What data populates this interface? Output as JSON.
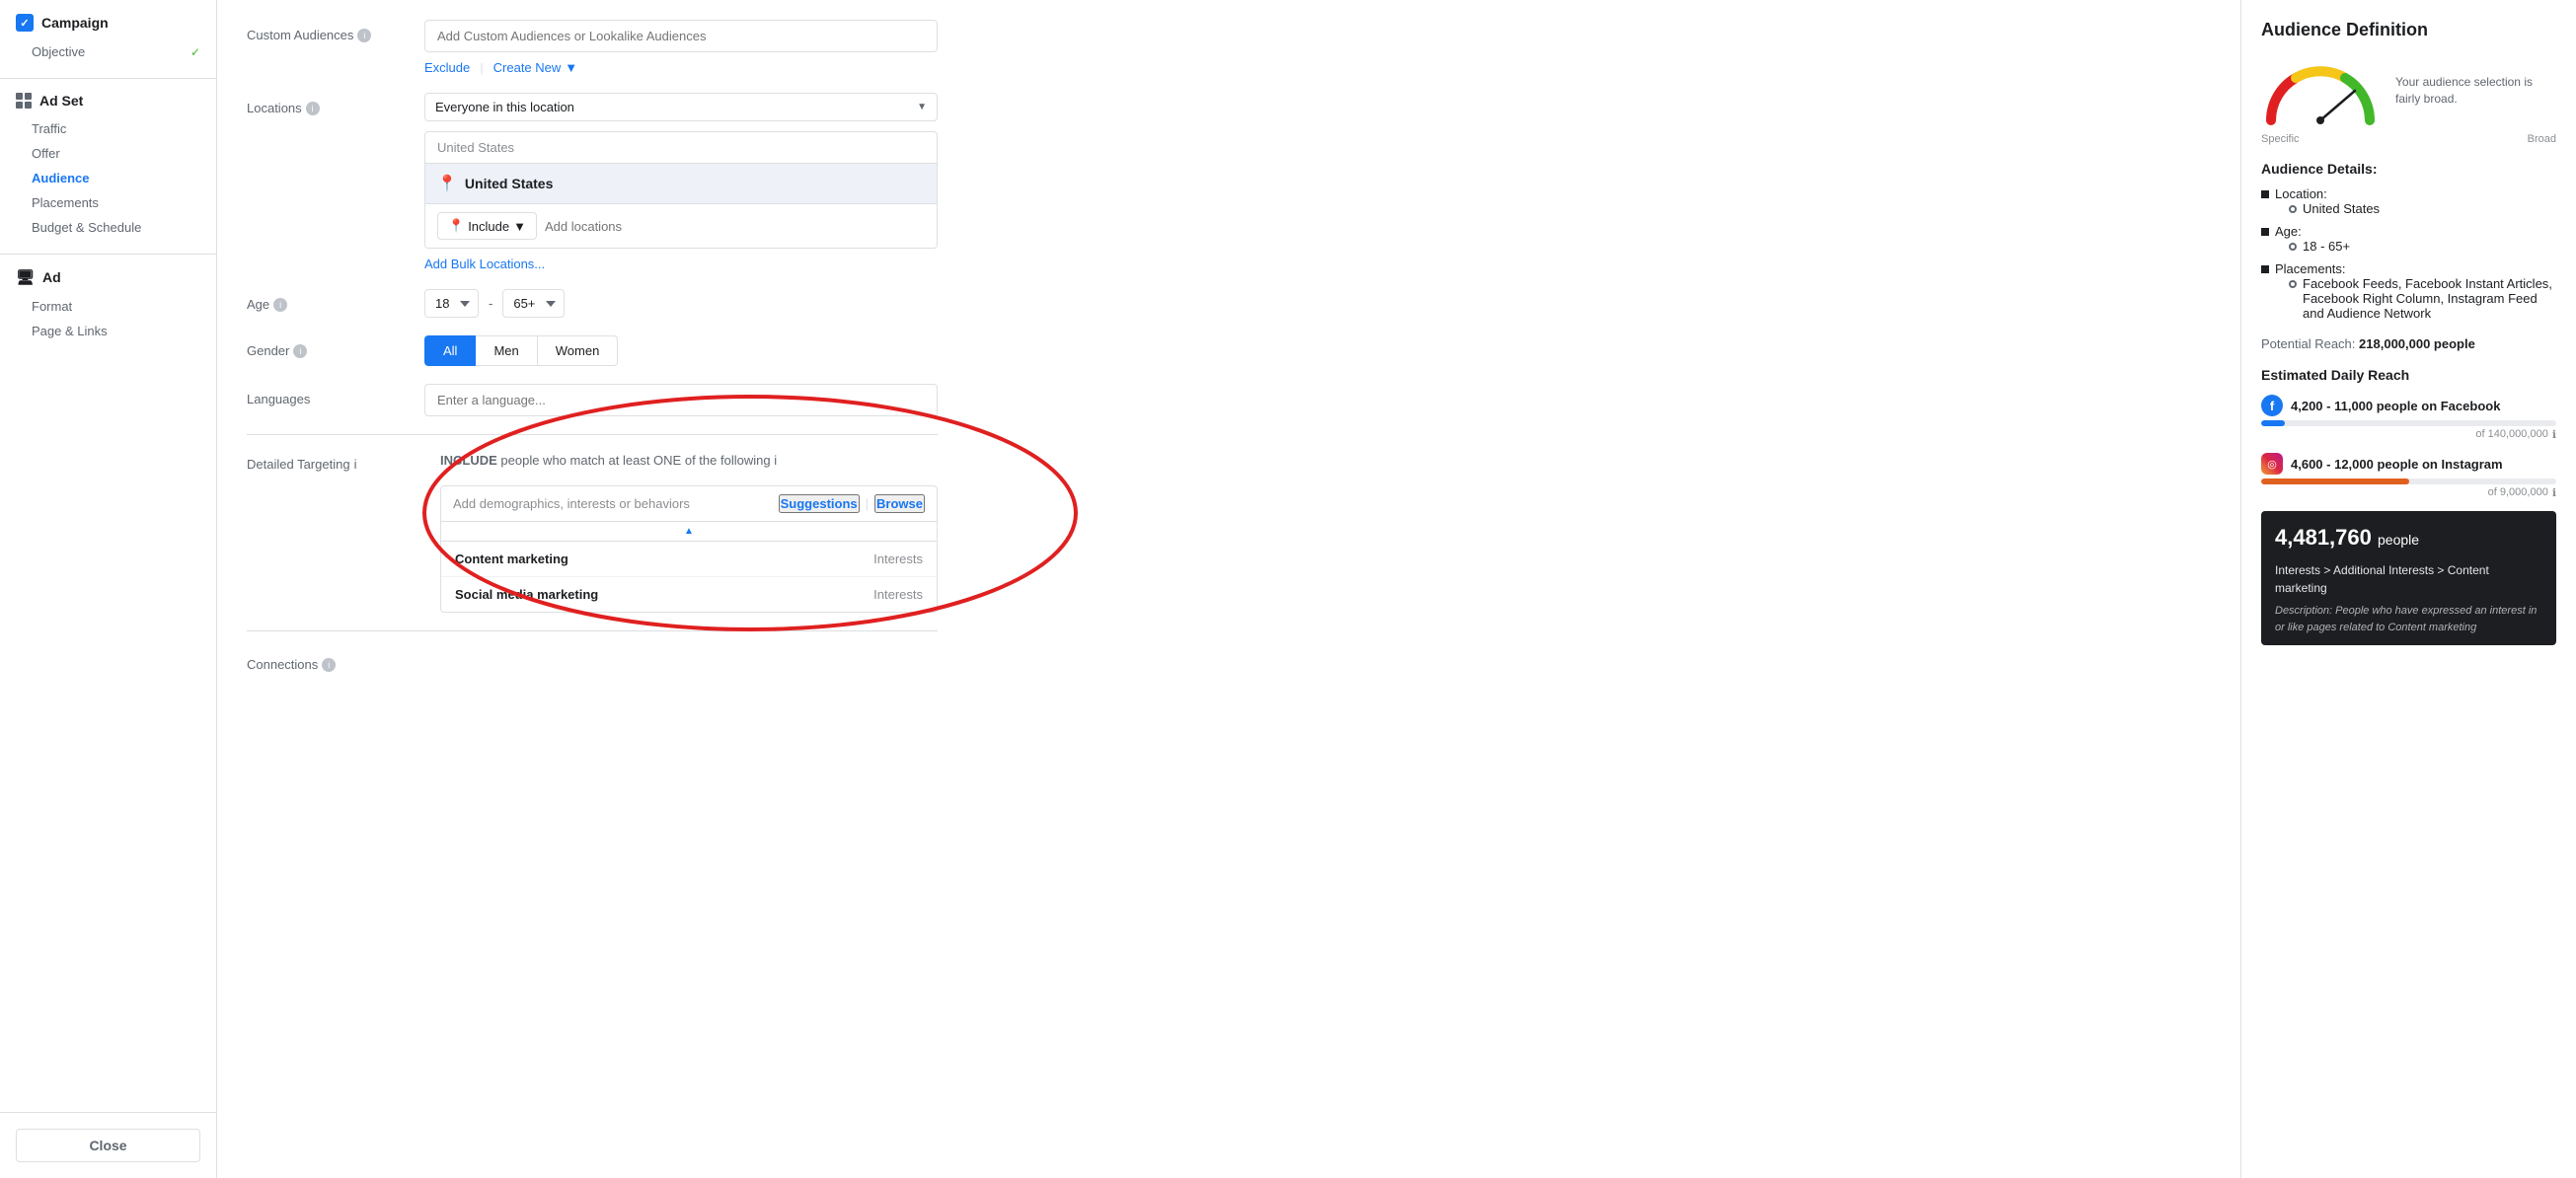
{
  "sidebar": {
    "campaign_label": "Campaign",
    "objective_label": "Objective",
    "adset_label": "Ad Set",
    "traffic_label": "Traffic",
    "offer_label": "Offer",
    "audience_label": "Audience",
    "placements_label": "Placements",
    "budget_label": "Budget & Schedule",
    "ad_label": "Ad",
    "format_label": "Format",
    "page_links_label": "Page & Links",
    "close_label": "Close"
  },
  "form": {
    "custom_audiences": {
      "label": "Custom Audiences",
      "placeholder": "Add Custom Audiences or Lookalike Audiences",
      "exclude_label": "Exclude",
      "create_new_label": "Create New"
    },
    "locations": {
      "label": "Locations",
      "dropdown_value": "Everyone in this location",
      "search_placeholder": "United States",
      "location_name": "United States",
      "include_label": "Include",
      "add_locations_placeholder": "Add locations",
      "bulk_link": "Add Bulk Locations..."
    },
    "age": {
      "label": "Age",
      "min": "18",
      "max": "65+",
      "dash": "-"
    },
    "gender": {
      "label": "Gender",
      "options": [
        "All",
        "Men",
        "Women"
      ],
      "active": "All"
    },
    "languages": {
      "label": "Languages",
      "placeholder": "Enter a language..."
    },
    "detailed_targeting": {
      "label": "Detailed Targeting",
      "include_text": "INCLUDE people who match at least ONE of the following",
      "add_placeholder": "Add demographics, interests or behaviors",
      "suggestions_label": "Suggestions",
      "browse_label": "Browse",
      "suggestions": [
        {
          "name": "Content marketing",
          "type": "Interests"
        },
        {
          "name": "Social media marketing",
          "type": "Interests"
        }
      ]
    },
    "connections": {
      "label": "Connections"
    }
  },
  "audience_definition": {
    "title": "Audience Definition",
    "gauge_text": "Your audience selection is fairly broad.",
    "specific_label": "Specific",
    "broad_label": "Broad",
    "details_title": "Audience Details:",
    "location_label": "Location:",
    "location_value": "United States",
    "age_label": "Age:",
    "age_value": "18 - 65+",
    "placements_label": "Placements:",
    "placements_value": "Facebook Feeds, Facebook Instant Articles, Facebook Right Column, Instagram Feed and Audience Network",
    "potential_reach_label": "Potential Reach:",
    "potential_reach_value": "218,000,000 people",
    "estimated_daily_title": "Estimated Daily Reach",
    "facebook_range": "4,200 - 11,000 people on Facebook",
    "facebook_of": "of 140,000,000",
    "instagram_range": "4,600 - 12,000 people on Instagram",
    "instagram_of": "of 9,000,000",
    "tooltip_number": "4,481,760",
    "tooltip_unit": "people",
    "tooltip_interests": "Interests > Additional Interests > Content marketing",
    "tooltip_description": "Description: People who have expressed an interest in or like pages related to Content marketing"
  }
}
